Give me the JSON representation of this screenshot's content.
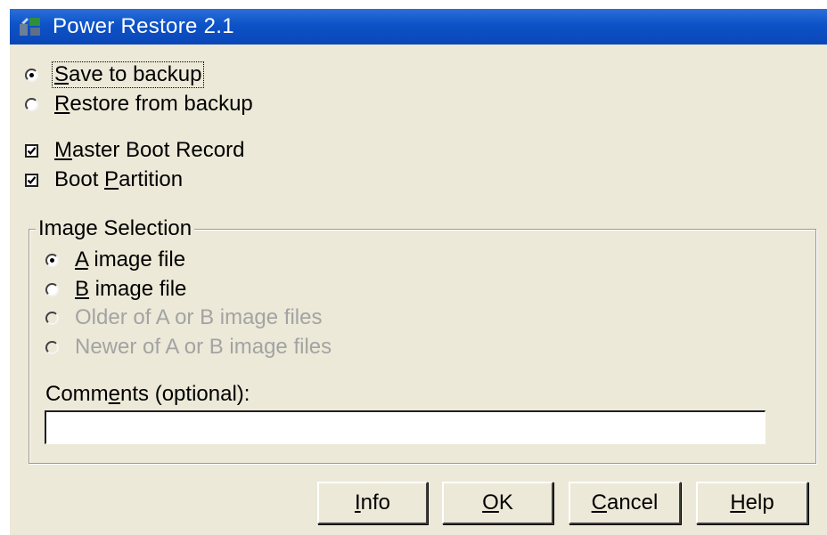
{
  "window": {
    "title": "Power Restore 2.1",
    "colors": {
      "titlebar": "#0a52c8",
      "face": "#ece9d8",
      "disabled_text": "#a3a3a3"
    }
  },
  "mode": {
    "options": [
      {
        "key": "S",
        "rest": "ave to backup",
        "selected": true
      },
      {
        "key": "R",
        "rest": "estore from backup",
        "selected": false
      }
    ]
  },
  "targets": {
    "master_boot_record": {
      "key": "M",
      "rest": "aster Boot Record",
      "checked": true
    },
    "boot_partition": {
      "pre": "Boot ",
      "key": "P",
      "rest": "artition",
      "checked": true
    }
  },
  "image_selection": {
    "title": "Image Selection",
    "options": [
      {
        "key": "A",
        "rest": " image file",
        "selected": true,
        "enabled": true
      },
      {
        "key": "B",
        "rest": " image file",
        "selected": false,
        "enabled": true
      },
      {
        "label": "Older of A or B image files",
        "selected": false,
        "enabled": false
      },
      {
        "label": "Newer of A or B image files",
        "selected": false,
        "enabled": false
      }
    ],
    "comments": {
      "label_pre": "Comm",
      "label_key": "e",
      "label_rest": "nts (optional):",
      "value": ""
    }
  },
  "buttons": {
    "info": {
      "key": "I",
      "rest": "nfo"
    },
    "ok": {
      "key": "O",
      "rest": "K"
    },
    "cancel": {
      "key": "C",
      "rest": "ancel"
    },
    "help": {
      "key": "H",
      "rest": "elp"
    }
  },
  "icons": {
    "app": "power-restore-app-icon",
    "radio_on": "radio-selected-icon",
    "radio_off": "radio-unselected-icon",
    "check_on": "checkbox-checked-icon"
  }
}
